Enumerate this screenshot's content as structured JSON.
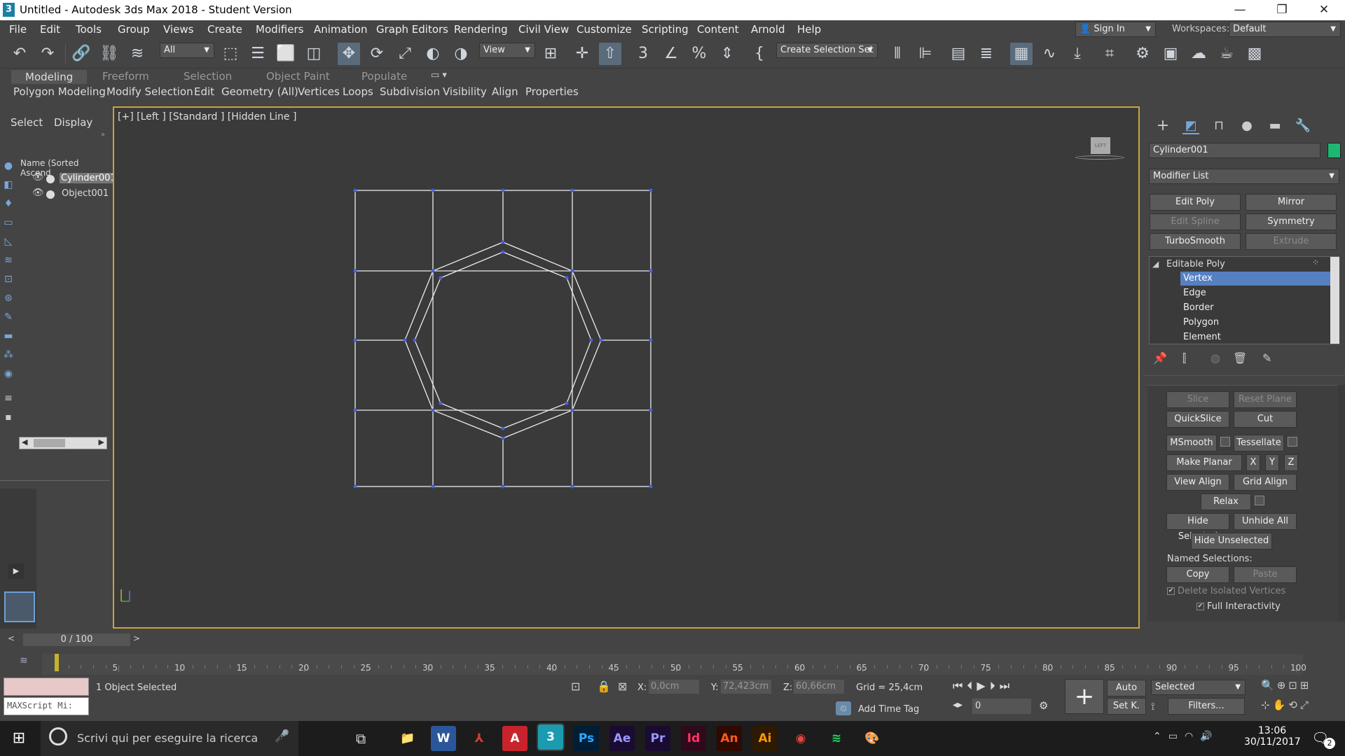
{
  "window": {
    "title": "Untitled - Autodesk 3ds Max 2018 - Student Version",
    "app_icon": "3",
    "min_icon": "—",
    "max_icon": "❐",
    "close_icon": "✕"
  },
  "menubar": {
    "items": [
      "File",
      "Edit",
      "Tools",
      "Group",
      "Views",
      "Create",
      "Modifiers",
      "Animation",
      "Graph Editors",
      "Rendering",
      "Civil View",
      "Customize",
      "Scripting",
      "Content",
      "Arnold",
      "Help"
    ],
    "sign_in": "Sign In",
    "workspaces_label": "Workspaces:",
    "workspace_value": "Default"
  },
  "toolbar": {
    "selection_filter": "All",
    "ref_coord": "View",
    "create_selection_set": "Create Selection Set"
  },
  "ribbon": {
    "tabs": [
      "Modeling",
      "Freeform",
      "Selection",
      "Object Paint",
      "Populate"
    ],
    "items": [
      "Polygon Modeling",
      "Modify Selection",
      "Edit",
      "Geometry (All)",
      "Vertices",
      "Loops",
      "Subdivision",
      "Visibility",
      "Align",
      "Properties"
    ]
  },
  "scene_explorer": {
    "tabs": [
      "Select",
      "Display"
    ],
    "column_header": "Name (Sorted Ascend",
    "objects": [
      "Cylinder001",
      "Object001"
    ]
  },
  "viewport": {
    "label": "[+] [Left ] [Standard ] [Hidden Line ]",
    "viewcube_label": "LEFT"
  },
  "command_panel": {
    "object_name": "Cylinder001",
    "object_color": "#1fb573",
    "modifier_list": "Modifier List",
    "modifier_buttons": [
      "Edit Poly",
      "Mirror",
      "Edit Spline",
      "Symmetry",
      "TurboSmooth",
      "Extrude"
    ],
    "stack_root": "Editable Poly",
    "stack_items": [
      "Vertex",
      "Edge",
      "Border",
      "Polygon",
      "Element"
    ],
    "selected_subobject": "Vertex",
    "edit_geometry": {
      "slice": "Slice",
      "reset_plane": "Reset Plane",
      "quickslice": "QuickSlice",
      "cut": "Cut",
      "msmooth": "MSmooth",
      "tessellate": "Tessellate",
      "make_planar": "Make Planar",
      "x": "X",
      "y": "Y",
      "z": "Z",
      "view_align": "View Align",
      "grid_align": "Grid Align",
      "relax": "Relax",
      "hide_selected": "Hide Selected",
      "unhide_all": "Unhide All",
      "hide_unselected": "Hide Unselected",
      "named_selections": "Named Selections:",
      "copy": "Copy",
      "paste": "Paste",
      "delete_isolated": "Delete Isolated Vertices",
      "full_interactivity": "Full Interactivity"
    }
  },
  "timeline": {
    "frame_display": "0 / 100",
    "ticks": [
      "5",
      "10",
      "15",
      "20",
      "25",
      "30",
      "35",
      "40",
      "45",
      "50",
      "55",
      "60",
      "65",
      "70",
      "75",
      "80",
      "85",
      "90",
      "95",
      "100"
    ]
  },
  "status": {
    "maxscript": "MAXScript Mi:",
    "selection_info": "1 Object Selected",
    "x_label": "X:",
    "x_value": "0,0cm",
    "y_label": "Y:",
    "y_value": "72,423cm",
    "z_label": "Z:",
    "z_value": "60,66cm",
    "grid": "Grid = 25,4cm",
    "add_time_tag": "Add Time Tag",
    "auto_key": "Auto",
    "set_key": "Set K.",
    "key_mode": "Selected",
    "filters": "Filters...",
    "frame_value": "0"
  },
  "taskbar": {
    "search_placeholder": "Scrivi qui per eseguire la ricerca",
    "time": "13:06",
    "date": "30/11/2017",
    "notification_count": "2",
    "apps": [
      {
        "name": "file-explorer",
        "label": "📁",
        "bg": "#1c1c1c",
        "fg": "#f2c230"
      },
      {
        "name": "word",
        "label": "W",
        "bg": "#2b579a",
        "fg": "#fff"
      },
      {
        "name": "acrobat",
        "label": "⅄",
        "bg": "#1c1c1c",
        "fg": "#e03a2f"
      },
      {
        "name": "autocad",
        "label": "A",
        "bg": "#c8232c",
        "fg": "#fff"
      },
      {
        "name": "3dsmax",
        "label": "3",
        "bg": "#1b9bb0",
        "fg": "#fff"
      },
      {
        "name": "photoshop",
        "label": "Ps",
        "bg": "#001e36",
        "fg": "#31a8ff"
      },
      {
        "name": "aftereffects",
        "label": "Ae",
        "bg": "#1a0b33",
        "fg": "#9999ff"
      },
      {
        "name": "premiere",
        "label": "Pr",
        "bg": "#1a0b33",
        "fg": "#9999ff"
      },
      {
        "name": "indesign",
        "label": "Id",
        "bg": "#2e0a1a",
        "fg": "#ff3366"
      },
      {
        "name": "animate",
        "label": "An",
        "bg": "#2e0a00",
        "fg": "#ff5a1f"
      },
      {
        "name": "illustrator",
        "label": "Ai",
        "bg": "#2e1a00",
        "fg": "#ff9a00"
      },
      {
        "name": "chrome",
        "label": "◉",
        "bg": "#1c1c1c",
        "fg": "#e8453c"
      },
      {
        "name": "spotify",
        "label": "≋",
        "bg": "#1c1c1c",
        "fg": "#1ed760"
      },
      {
        "name": "paint",
        "label": "🎨",
        "bg": "#1c1c1c",
        "fg": "#8ac"
      }
    ]
  }
}
